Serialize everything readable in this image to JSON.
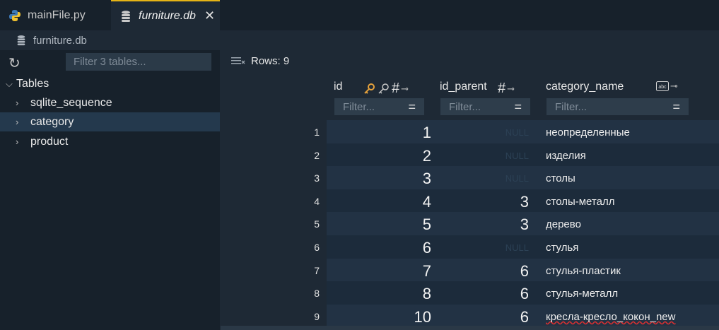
{
  "tabs": [
    {
      "label": "mainFile.py",
      "icon": "python-icon"
    },
    {
      "label": "furniture.db",
      "icon": "database-icon",
      "close": "✕"
    }
  ],
  "breadcrumb": {
    "label": "furniture.db"
  },
  "sidebar": {
    "filter_placeholder": "Filter 3 tables...",
    "root": "Tables",
    "items": [
      "sqlite_sequence",
      "category",
      "product"
    ]
  },
  "rows_label": "Rows: 9",
  "columns": [
    {
      "name": "id",
      "filter_placeholder": "Filter..."
    },
    {
      "name": "id_parent",
      "filter_placeholder": "Filter..."
    },
    {
      "name": "category_name",
      "filter_placeholder": "Filter..."
    }
  ],
  "rows": [
    {
      "n": "1",
      "id": "1",
      "id_parent": "NULL",
      "name": "неопределенные"
    },
    {
      "n": "2",
      "id": "2",
      "id_parent": "NULL",
      "name": "изделия"
    },
    {
      "n": "3",
      "id": "3",
      "id_parent": "NULL",
      "name": "столы"
    },
    {
      "n": "4",
      "id": "4",
      "id_parent": "3",
      "name": "столы-металл"
    },
    {
      "n": "5",
      "id": "5",
      "id_parent": "3",
      "name": "дерево"
    },
    {
      "n": "6",
      "id": "6",
      "id_parent": "NULL",
      "name": "стулья"
    },
    {
      "n": "7",
      "id": "7",
      "id_parent": "6",
      "name": "стулья-пластик"
    },
    {
      "n": "8",
      "id": "8",
      "id_parent": "6",
      "name": "стулья-металл"
    },
    {
      "n": "9",
      "id": "10",
      "id_parent": "6",
      "name": "кресла-кресло_кокон_new"
    }
  ],
  "colors": {
    "accent": "#e6b416",
    "row_even": "#223244",
    "row_odd": "#1c2b3b",
    "selected": "#24394d"
  }
}
